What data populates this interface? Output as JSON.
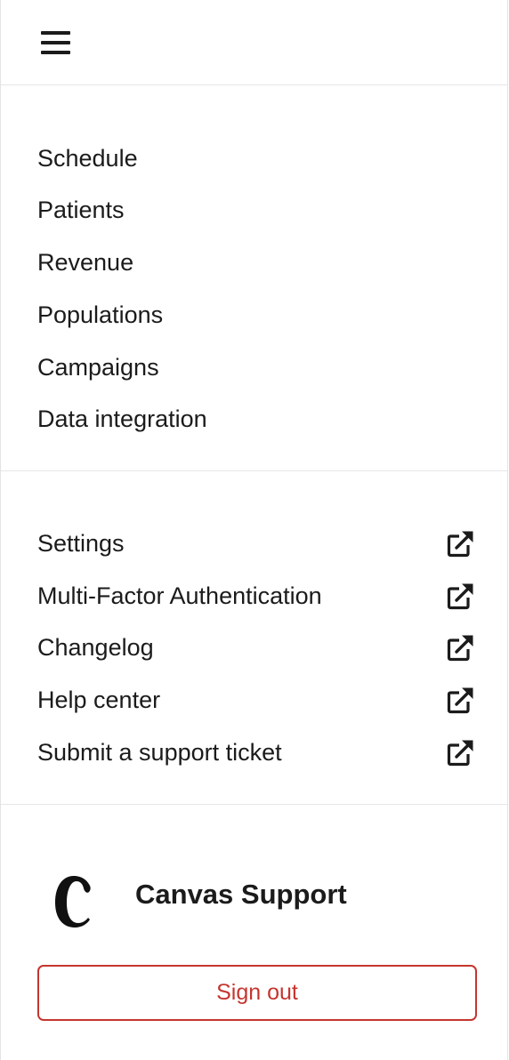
{
  "header": {
    "menu_icon": "hamburger-menu-icon"
  },
  "main_nav": {
    "items": [
      {
        "label": "Schedule"
      },
      {
        "label": "Patients"
      },
      {
        "label": "Revenue"
      },
      {
        "label": "Populations"
      },
      {
        "label": "Campaigns"
      },
      {
        "label": "Data integration"
      }
    ]
  },
  "external_nav": {
    "icon": "external-link-icon",
    "items": [
      {
        "label": "Settings"
      },
      {
        "label": "Multi-Factor Authentication"
      },
      {
        "label": "Changelog"
      },
      {
        "label": "Help center"
      },
      {
        "label": "Submit a support ticket"
      }
    ]
  },
  "footer": {
    "logo_icon": "canvas-logo-icon",
    "user_name": "Canvas Support",
    "sign_out_label": "Sign out"
  },
  "colors": {
    "text": "#1b1b1b",
    "danger": "#c5352f",
    "divider": "#e6e6e6"
  }
}
